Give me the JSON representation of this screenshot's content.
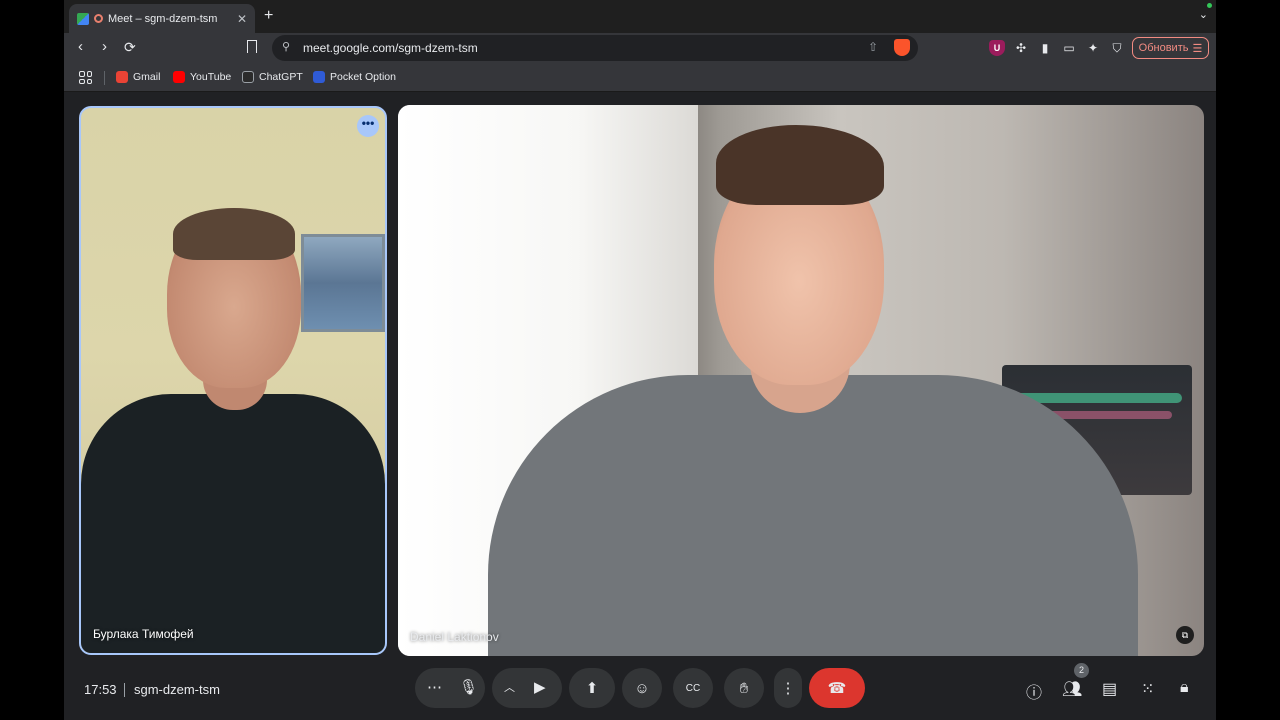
{
  "browser": {
    "tab": {
      "title": "Meet – sgm-dzem-tsm",
      "close": "✕"
    },
    "new_tab": "+",
    "url": "meet.google.com/sgm-dzem-tsm",
    "update_label": "Обновить",
    "bookmarks": [
      {
        "label": "Gmail",
        "color": "#ea4335"
      },
      {
        "label": "YouTube",
        "color": "#ff0000"
      },
      {
        "label": "ChatGPT",
        "color": "#2b2b2b"
      },
      {
        "label": "Pocket Option",
        "color": "#2f5bd6"
      }
    ]
  },
  "meet": {
    "participants": [
      {
        "name": "Бурлака Тимофей",
        "active_speaker": true
      },
      {
        "name": "Daniel Laktionov",
        "active_speaker": false
      }
    ],
    "time": "17:53",
    "meeting_code": "sgm-dzem-tsm",
    "people_count": "2",
    "colors": {
      "end_call": "#dc362e",
      "speaker_border": "#a8c7fa",
      "control_bg": "#333537"
    },
    "icons": {
      "more": "more-horiz-icon",
      "mic": "mic-icon",
      "camera": "videocam-icon",
      "present": "present-screen-icon",
      "emoji": "emoji-icon",
      "captions": "captions-icon",
      "hand": "raise-hand-icon",
      "options": "more-vert-icon",
      "end": "call-end-icon",
      "info": "info-icon",
      "people": "people-icon",
      "chat": "chat-icon",
      "activities": "apps-icon",
      "host": "host-controls-icon"
    }
  }
}
